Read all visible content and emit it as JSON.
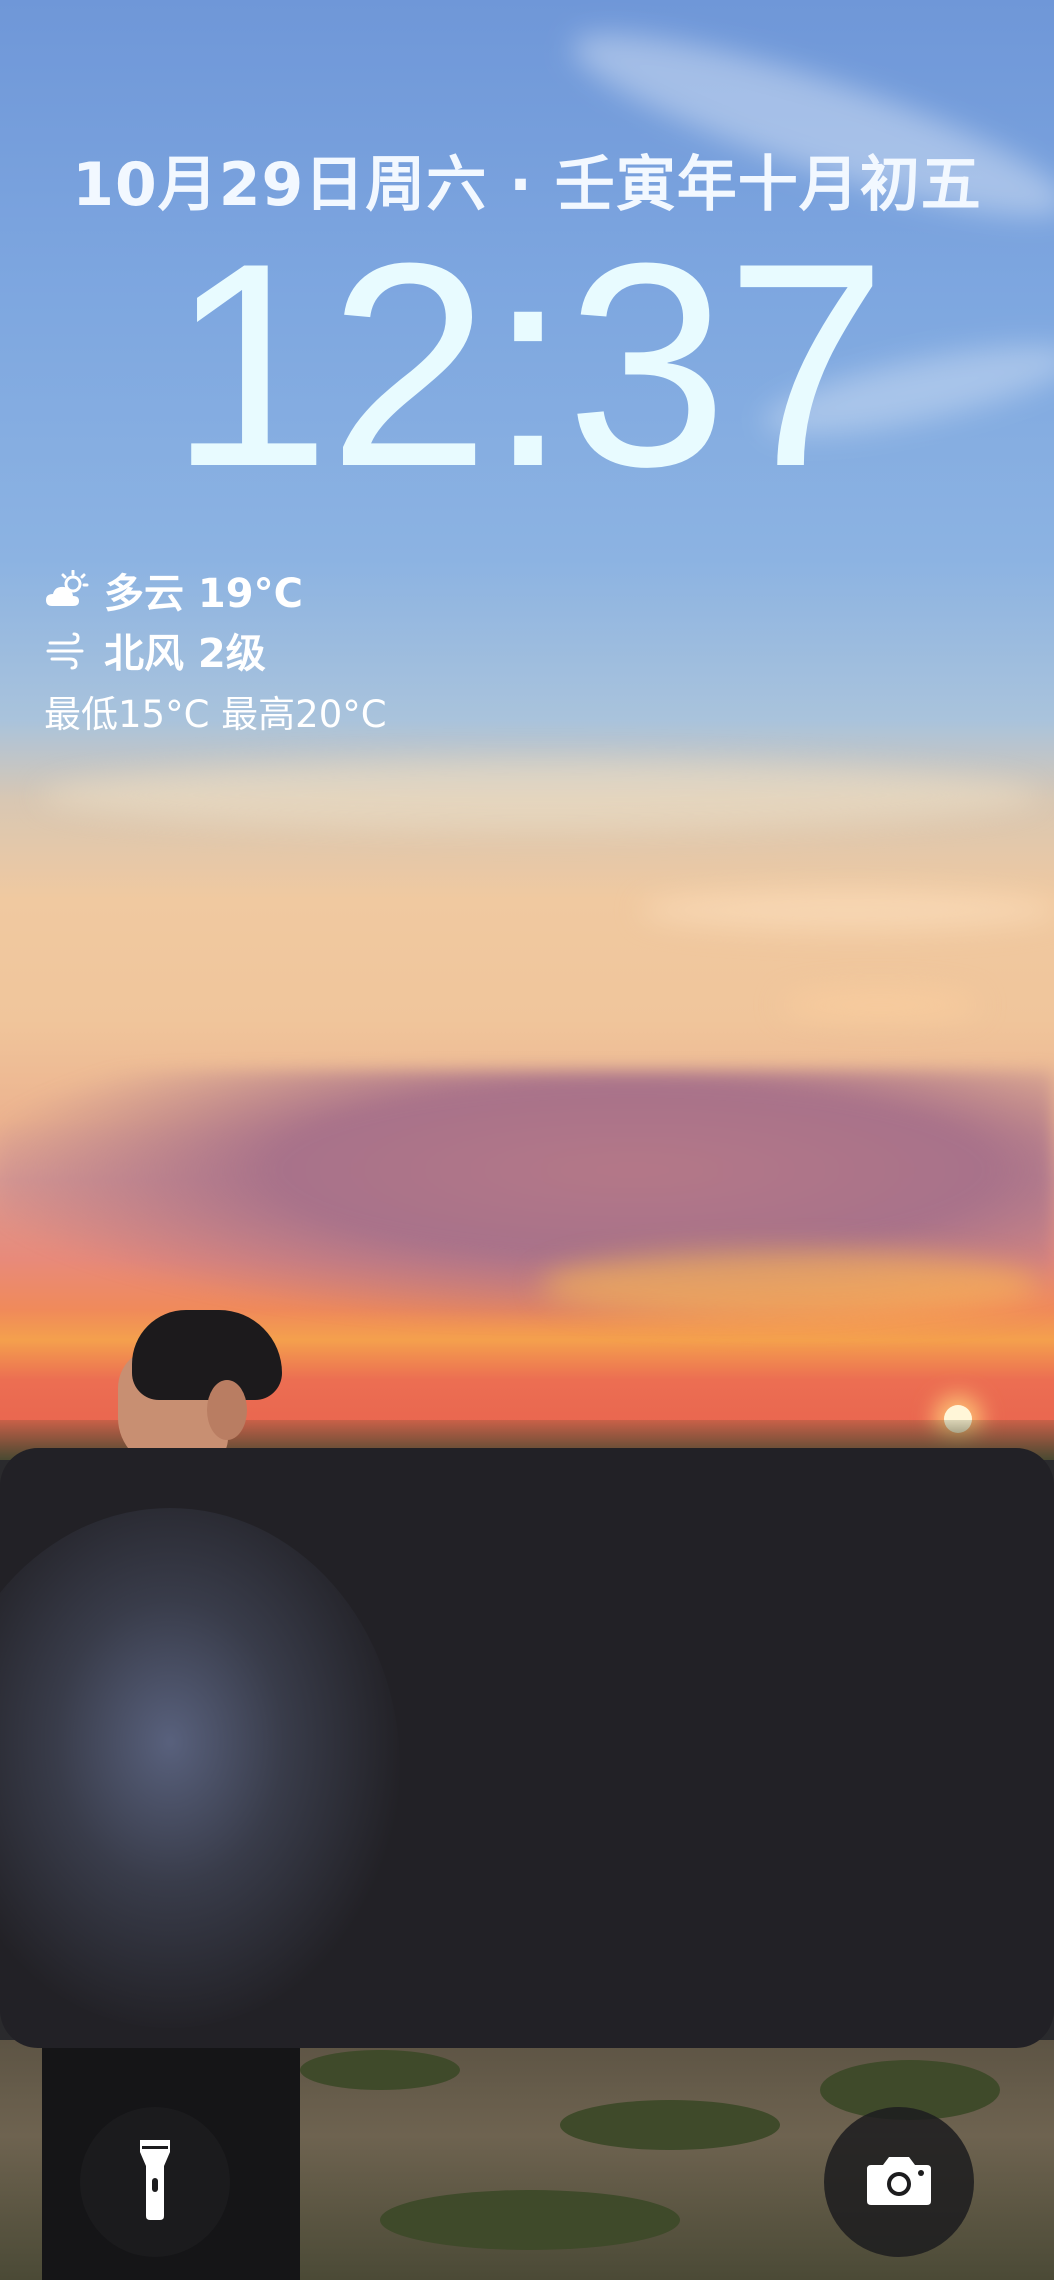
{
  "lockscreen": {
    "date": "10月29日周六 · 壬寅年十月初五",
    "time": "12:37"
  },
  "weather": {
    "condition_icon": "cloud-sun-icon",
    "condition": "多云 19°C",
    "wind_icon": "wind-icon",
    "wind": "北风 2级",
    "range": "最低15°C 最高20°C"
  },
  "quick_actions": {
    "flashlight_icon": "flashlight-icon",
    "camera_icon": "camera-icon"
  },
  "colors": {
    "text": "#ffffff",
    "clock": "#e8fbff",
    "panel": "#222126"
  }
}
